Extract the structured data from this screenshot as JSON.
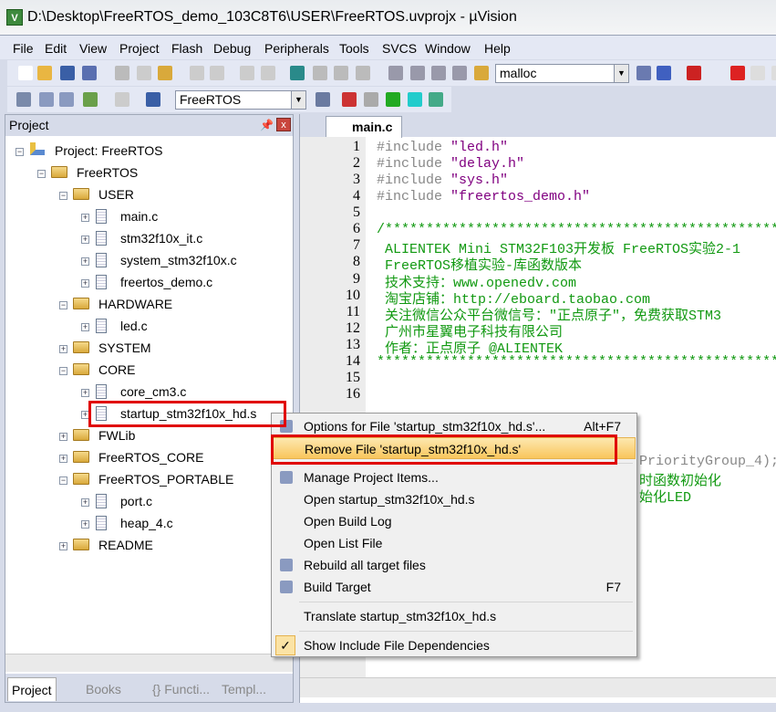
{
  "window": {
    "title": "D:\\Desktop\\FreeRTOS_demo_103C8T6\\USER\\FreeRTOS.uvprojx - µVision"
  },
  "menu": [
    "File",
    "Edit",
    "View",
    "Project",
    "Flash",
    "Debug",
    "Peripherals",
    "Tools",
    "SVCS",
    "Window",
    "Help"
  ],
  "toolbar": {
    "find_value": "malloc",
    "target_value": "FreeRTOS"
  },
  "project_panel": {
    "title": "Project",
    "tree": [
      {
        "label": "Project: FreeRTOS",
        "level": 0,
        "type": "project",
        "expanded": true
      },
      {
        "label": "FreeRTOS",
        "level": 1,
        "type": "target",
        "expanded": true
      },
      {
        "label": "USER",
        "level": 2,
        "type": "folder",
        "expanded": true
      },
      {
        "label": "main.c",
        "level": 3,
        "type": "file"
      },
      {
        "label": "stm32f10x_it.c",
        "level": 3,
        "type": "file"
      },
      {
        "label": "system_stm32f10x.c",
        "level": 3,
        "type": "file"
      },
      {
        "label": "freertos_demo.c",
        "level": 3,
        "type": "file"
      },
      {
        "label": "HARDWARE",
        "level": 2,
        "type": "folder",
        "expanded": true
      },
      {
        "label": "led.c",
        "level": 3,
        "type": "file"
      },
      {
        "label": "SYSTEM",
        "level": 2,
        "type": "folder",
        "expanded": false
      },
      {
        "label": "CORE",
        "level": 2,
        "type": "folder",
        "expanded": true
      },
      {
        "label": "core_cm3.c",
        "level": 3,
        "type": "file"
      },
      {
        "label": "startup_stm32f10x_hd.s",
        "level": 3,
        "type": "file",
        "selected": true
      },
      {
        "label": "FWLib",
        "level": 2,
        "type": "folder",
        "expanded": false
      },
      {
        "label": "FreeRTOS_CORE",
        "level": 2,
        "type": "folder",
        "expanded": false
      },
      {
        "label": "FreeRTOS_PORTABLE",
        "level": 2,
        "type": "folder",
        "expanded": true
      },
      {
        "label": "port.c",
        "level": 3,
        "type": "file"
      },
      {
        "label": "heap_4.c",
        "level": 3,
        "type": "file"
      },
      {
        "label": "README",
        "level": 2,
        "type": "folder",
        "expanded": false
      }
    ],
    "tabs": [
      "Project",
      "Books",
      "{} Functi...",
      "Templ..."
    ]
  },
  "editor": {
    "tab": "main.c",
    "lines": [
      {
        "n": "1",
        "parts": [
          [
            "kw",
            "#include "
          ],
          [
            "str",
            "\"led.h\""
          ]
        ]
      },
      {
        "n": "2",
        "parts": [
          [
            "kw",
            "#include "
          ],
          [
            "str",
            "\"delay.h\""
          ]
        ]
      },
      {
        "n": "3",
        "parts": [
          [
            "kw",
            "#include "
          ],
          [
            "str",
            "\"sys.h\""
          ]
        ]
      },
      {
        "n": "4",
        "parts": [
          [
            "kw",
            "#include "
          ],
          [
            "str",
            "\"freertos_demo.h\""
          ]
        ]
      },
      {
        "n": "5",
        "parts": []
      },
      {
        "n": "6",
        "parts": [
          [
            "cm",
            "/****************************************************"
          ]
        ]
      },
      {
        "n": "7",
        "parts": [
          [
            "cm",
            " ALIENTEK Mini STM32F103开发板 FreeRTOS实验2-1"
          ]
        ]
      },
      {
        "n": "8",
        "parts": [
          [
            "cm",
            " FreeRTOS移植实验-库函数版本"
          ]
        ]
      },
      {
        "n": "9",
        "parts": [
          [
            "cm",
            " 技术支持：www.openedv.com"
          ]
        ]
      },
      {
        "n": "10",
        "parts": [
          [
            "cm",
            " 淘宝店铺：http://eboard.taobao.com"
          ]
        ]
      },
      {
        "n": "11",
        "parts": [
          [
            "cm",
            " 关注微信公众平台微信号：\"正点原子\"，免费获取STM3"
          ]
        ]
      },
      {
        "n": "12",
        "parts": [
          [
            "cm",
            " 广州市星翼电子科技有限公司"
          ]
        ]
      },
      {
        "n": "13",
        "parts": [
          [
            "cm",
            " 作者：正点原子 @ALIENTEK"
          ]
        ]
      },
      {
        "n": "14",
        "parts": [
          [
            "cm",
            "****************************************************/"
          ]
        ]
      },
      {
        "n": "15",
        "parts": []
      },
      {
        "n": "16",
        "parts": []
      }
    ],
    "partial_lines": [
      [
        "kw",
        "PriorityGroup_4);"
      ],
      [
        "cm",
        "时函数初始化"
      ],
      [
        "cm",
        "始化LED"
      ]
    ]
  },
  "context_menu": {
    "items": [
      {
        "label": "Options for File 'startup_stm32f10x_hd.s'...",
        "shortcut": "Alt+F7",
        "icon": "options-icon"
      },
      {
        "label": "Remove File 'startup_stm32f10x_hd.s'",
        "highlighted": true
      },
      {
        "sep": true
      },
      {
        "label": "Manage Project Items...",
        "icon": "manage-items-icon"
      },
      {
        "label": "Open startup_stm32f10x_hd.s"
      },
      {
        "label": "Open Build Log"
      },
      {
        "label": "Open List File"
      },
      {
        "label": "Rebuild all target files",
        "icon": "rebuild-icon"
      },
      {
        "label": "Build Target",
        "shortcut": "F7",
        "icon": "build-icon"
      },
      {
        "sep": true
      },
      {
        "label": "Translate startup_stm32f10x_hd.s"
      },
      {
        "sep": true
      },
      {
        "label": "Show Include File Dependencies",
        "checked": true
      }
    ]
  },
  "colors": {
    "highlight_box": "#e00000",
    "comment": "#119911",
    "string": "#800080"
  }
}
